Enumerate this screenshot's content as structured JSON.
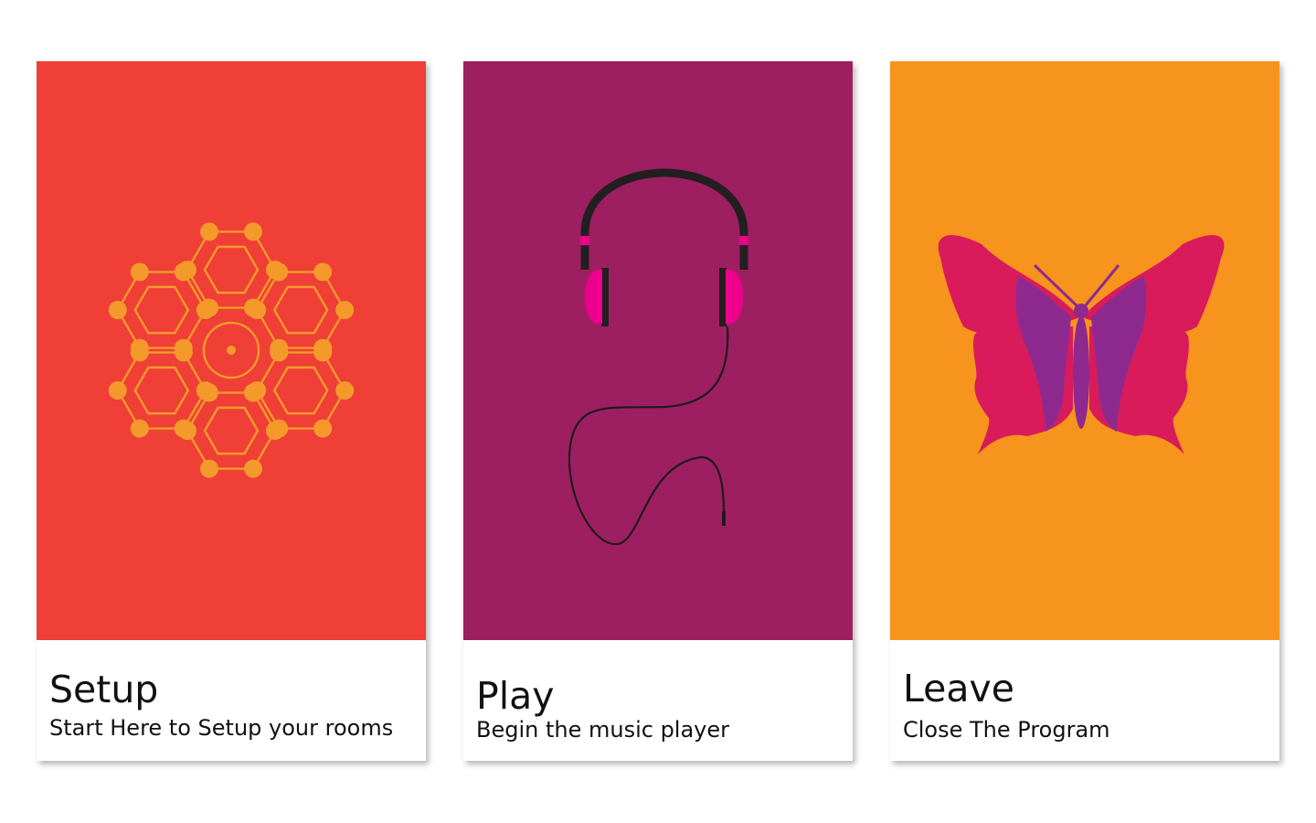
{
  "cards": [
    {
      "id": "setup",
      "title": "Setup",
      "subtitle": "Start Here to Setup your rooms",
      "icon": "hexagon-network-icon",
      "background_color": "#ef3f36",
      "icon_color": "#f39a2b"
    },
    {
      "id": "play",
      "title": "Play",
      "subtitle": "Begin the music player",
      "icon": "headphones-icon",
      "background_color": "#9e1f61",
      "icon_color": "#ec008c"
    },
    {
      "id": "leave",
      "title": "Leave",
      "subtitle": "Close The Program",
      "icon": "butterfly-icon",
      "background_color": "#f7941d",
      "icon_color": "#d91b5c"
    }
  ]
}
